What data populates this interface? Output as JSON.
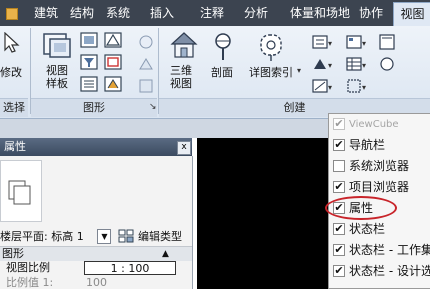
{
  "tabs": [
    "建筑",
    "结构",
    "系统",
    "插入",
    "注释",
    "分析",
    "体量和场地",
    "协作",
    "视图"
  ],
  "active_tab": "视图",
  "ribbon": {
    "modify_label": "修改",
    "select_label": "选择",
    "graphics": {
      "view_template_label": "视图\n样板",
      "panel_label": "图形"
    },
    "create": {
      "threed_view_label": "三维\n视图",
      "section_label": "剖面",
      "callout_label": "详图索引",
      "panel_label": "创建"
    }
  },
  "properties": {
    "title": "属性",
    "close_label": "x",
    "floor_plan_label": "楼层平面: 标高 1",
    "edit_type_label": "编辑类型",
    "group_label": "图形",
    "rows": [
      {
        "name": "视图比例",
        "value": "1 : 100"
      },
      {
        "name": "比例值 1:",
        "value": "100"
      }
    ]
  },
  "context_menu": {
    "items": [
      {
        "label": "ViewCube",
        "checked": true,
        "disabled": true
      },
      {
        "label": "导航栏",
        "checked": true,
        "disabled": false
      },
      {
        "label": "系统浏览器",
        "checked": false,
        "disabled": false
      },
      {
        "label": "项目浏览器",
        "checked": true,
        "disabled": false
      },
      {
        "label": "属性",
        "checked": true,
        "disabled": false
      },
      {
        "label": "状态栏",
        "checked": true,
        "disabled": false
      },
      {
        "label": "状态栏 - 工作集",
        "checked": true,
        "disabled": false
      },
      {
        "label": "状态栏 - 设计选",
        "checked": true,
        "disabled": false
      }
    ]
  },
  "colors": {
    "tab_bar": "#3c4450",
    "ribbon": "#dbe5f1",
    "canvas": "#000000",
    "highlight": "#c8242a"
  }
}
